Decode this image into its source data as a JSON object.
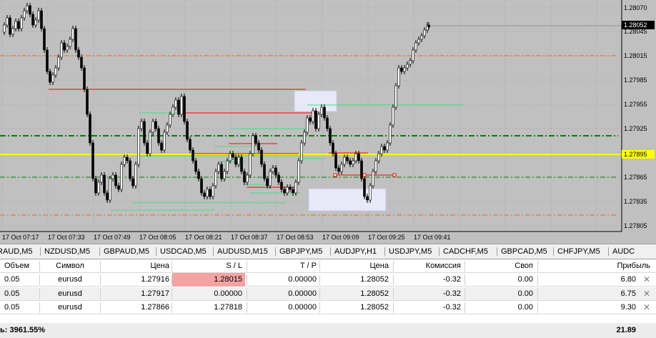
{
  "chart": {
    "price_labels": [
      "1.28070",
      "1.28045",
      "1.28015",
      "1.27985",
      "1.27955",
      "1.27925",
      "1.27895",
      "1.27865",
      "1.27835",
      "1.27805"
    ],
    "current_price": "1.28052",
    "yellow_price": "1.27895",
    "time_labels": [
      "17 Oct 07:17",
      "17 Oct 07:33",
      "17 Oct 07:49",
      "17 Oct 08:05",
      "17 Oct 08:21",
      "17 Oct 08:37",
      "17 Oct 08:53",
      "17 Oct 09:09",
      "17 Oct 09:25",
      "17 Oct 09:41"
    ],
    "colors": {
      "background": "#c0c0c0",
      "grid": "#a8a8a8",
      "candles": "#000000",
      "red_line": "#ff0000",
      "green_line": "#00c040",
      "orange_dash": "#ff6000",
      "green_dash": "#008000",
      "yellow_line": "#ffff00"
    }
  },
  "tabs": [
    "RAUD,M5",
    "NZDUSD,M5",
    "GBPAUD,M5",
    "USDCAD,M5",
    "AUDUSD,M15",
    "GBPJPY,M5",
    "AUDJPY,H1",
    "USDJPY,M5",
    "CADCHF,M5",
    "GBPCAD,M5",
    "CHFJPY,M5",
    "AUDC"
  ],
  "table": {
    "headers": [
      "Объем",
      "Символ",
      "Цена",
      "S / L",
      "T / P",
      "Цена",
      "Комиссия",
      "Своп",
      "Прибыль"
    ],
    "rows": [
      {
        "volume": "0.05",
        "symbol": "eurusd",
        "price": "1.27916",
        "sl": "1.28015",
        "tp": "0.00000",
        "cur": "1.28052",
        "commission": "-0.32",
        "swap": "0.00",
        "profit": "6.80"
      },
      {
        "volume": "0.05",
        "symbol": "eurusd",
        "price": "1.27917",
        "sl": "0.00000",
        "tp": "0.00000",
        "cur": "1.28052",
        "commission": "-0.32",
        "swap": "0.00",
        "profit": "6.75"
      },
      {
        "volume": "0.05",
        "symbol": "eurusd",
        "price": "1.27866",
        "sl": "1.27818",
        "tp": "0.00000",
        "cur": "1.28052",
        "commission": "-0.32",
        "swap": "0.00",
        "profit": "9.30"
      }
    ],
    "summary_label": "ь: 3961.55%",
    "summary_profit": "21.89",
    "close_glyph": "✕"
  }
}
